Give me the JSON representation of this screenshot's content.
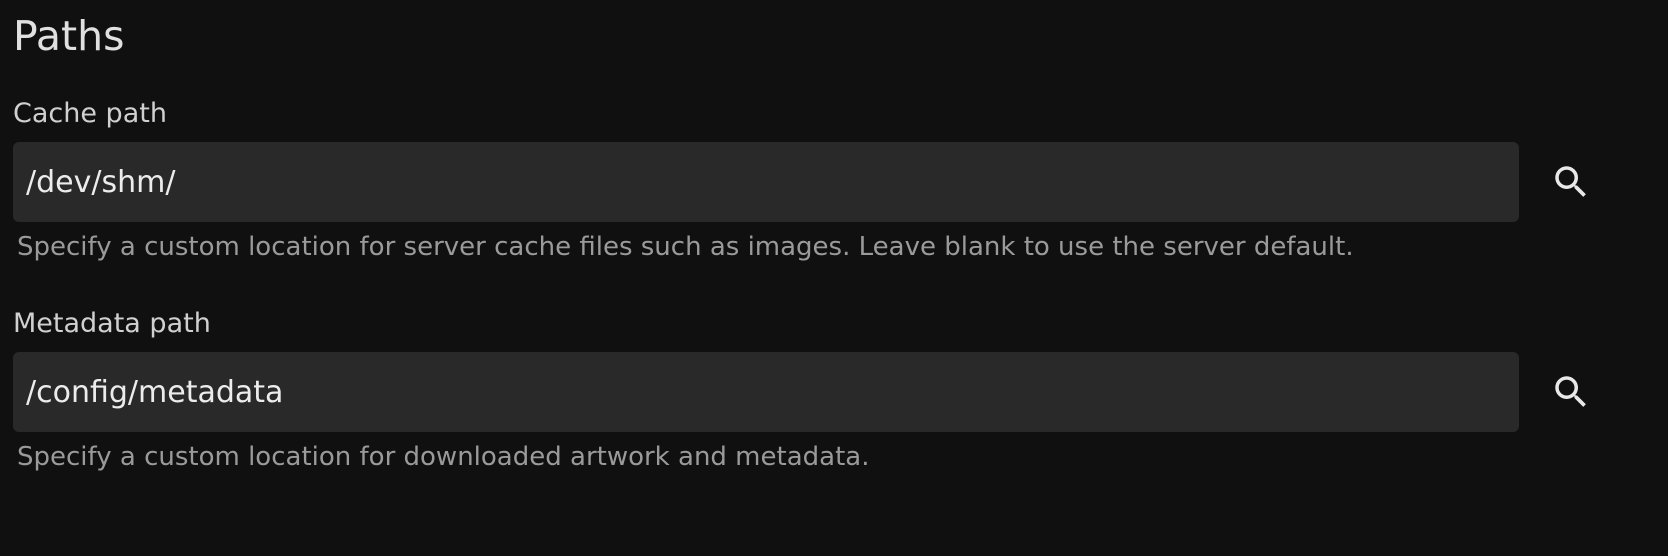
{
  "section": {
    "title": "Paths"
  },
  "cache_path": {
    "label": "Cache path",
    "value": "/dev/shm/",
    "description": "Specify a custom location for server cache files such as images. Leave blank to use the server default.",
    "button_icon": "search-icon"
  },
  "metadata_path": {
    "label": "Metadata path",
    "value": "/config/metadata",
    "description": "Specify a custom location for downloaded artwork and metadata.",
    "button_icon": "search-icon"
  },
  "colors": {
    "background": "#101010",
    "input_background": "#292929",
    "text_primary": "#e0e0e0",
    "text_secondary": "#9a9a9a"
  }
}
